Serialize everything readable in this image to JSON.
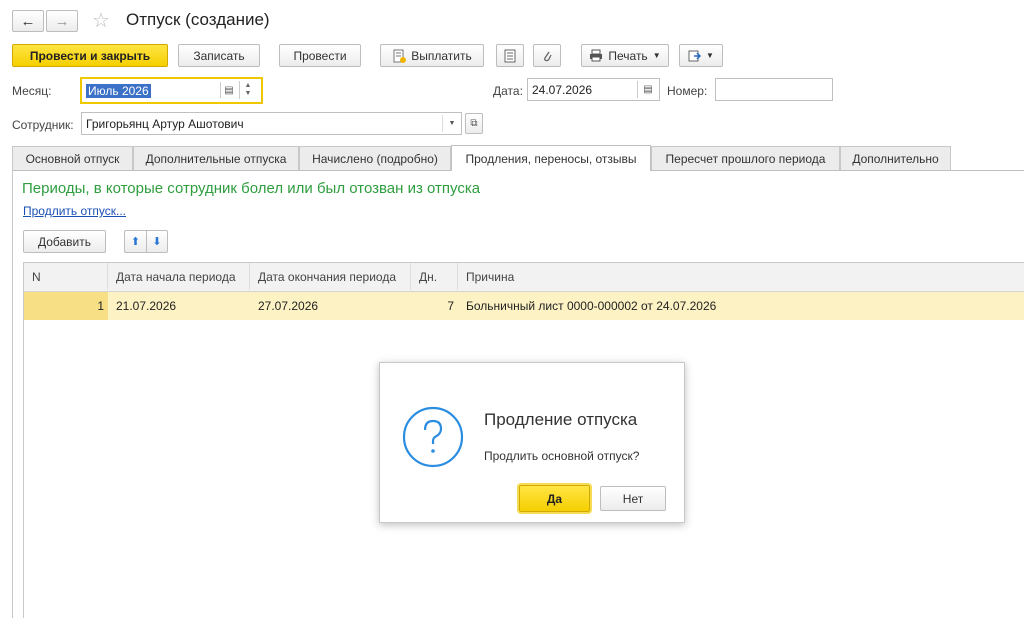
{
  "header": {
    "title": "Отпуск (создание)",
    "back_icon": "←",
    "forward_icon": "→",
    "star_icon": "☆"
  },
  "toolbar": {
    "post_close_label": "Провести и закрыть",
    "save_label": "Записать",
    "post_label": "Провести",
    "pay_label": "Выплатить",
    "print_label": "Печать"
  },
  "form": {
    "month_label": "Месяц:",
    "month_value": "Июль 2026",
    "date_label": "Дата:",
    "date_value": "24.07.2026",
    "number_label": "Номер:",
    "number_value": "",
    "employee_label": "Сотрудник:",
    "employee_value": "Григорьянц Артур Ашотович"
  },
  "tabs": [
    {
      "label": "Основной отпуск"
    },
    {
      "label": "Дополнительные отпуска"
    },
    {
      "label": "Начислено (подробно)"
    },
    {
      "label": "Продления, переносы, отзывы"
    },
    {
      "label": "Пересчет прошлого периода"
    },
    {
      "label": "Дополнительно"
    }
  ],
  "section": {
    "heading": "Периоды, в которые сотрудник болел или был отозван из отпуска",
    "extend_link": "Продлить отпуск...",
    "add_label": "Добавить"
  },
  "table": {
    "columns": [
      "N",
      "Дата начала периода",
      "Дата окончания периода",
      "Дн.",
      "Причина"
    ],
    "rows": [
      {
        "n": "1",
        "start": "21.07.2026",
        "end": "27.07.2026",
        "days": "7",
        "reason": "Больничный лист 0000-000002 от 24.07.2026"
      }
    ]
  },
  "dialog": {
    "title": "Продление отпуска",
    "message": "Продлить основной отпуск?",
    "yes_label": "Да",
    "no_label": "Нет"
  },
  "colors": {
    "accent_yellow": "#f5cf00",
    "heading_green": "#2e9e3e",
    "link_blue": "#1a4fb5",
    "selected_row": "#fdf2c4"
  }
}
